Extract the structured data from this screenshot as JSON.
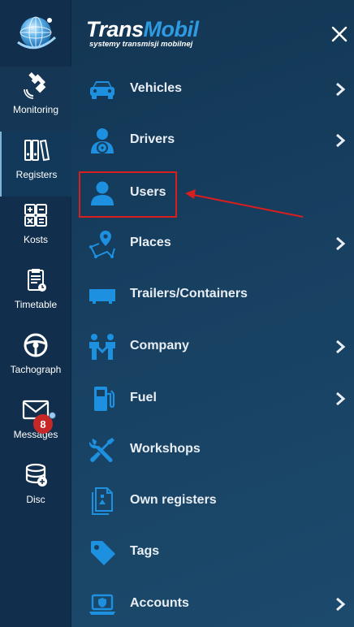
{
  "brand": {
    "name_part1": "Trans",
    "name_part2": "Mobil",
    "subtitle": "systemy transmisji mobilnej"
  },
  "rail": {
    "items": [
      {
        "label": "Monitoring",
        "icon": "satellite-icon"
      },
      {
        "label": "Registers",
        "icon": "binders-icon"
      },
      {
        "label": "Kosts",
        "icon": "calculator-icon"
      },
      {
        "label": "Timetable",
        "icon": "clipboard-icon"
      },
      {
        "label": "Tachograph",
        "icon": "steering-wheel-icon"
      },
      {
        "label": "Messages",
        "icon": "envelope-icon"
      },
      {
        "label": "Disc",
        "icon": "database-icon"
      }
    ],
    "messages_badge": "8"
  },
  "menu": {
    "items": [
      {
        "label": "Vehicles",
        "icon": "car-icon",
        "has_submenu": true
      },
      {
        "label": "Drivers",
        "icon": "driver-icon",
        "has_submenu": true
      },
      {
        "label": "Users",
        "icon": "user-icon",
        "has_submenu": false
      },
      {
        "label": "Places",
        "icon": "map-location-icon",
        "has_submenu": true
      },
      {
        "label": "Trailers/Containers",
        "icon": "trailer-icon",
        "has_submenu": false
      },
      {
        "label": "Company",
        "icon": "people-icon",
        "has_submenu": true
      },
      {
        "label": "Fuel",
        "icon": "fuel-pump-icon",
        "has_submenu": true
      },
      {
        "label": "Workshops",
        "icon": "tools-icon",
        "has_submenu": false
      },
      {
        "label": "Own registers",
        "icon": "documents-icon",
        "has_submenu": false
      },
      {
        "label": "Tags",
        "icon": "tag-icon",
        "has_submenu": false
      },
      {
        "label": "Accounts",
        "icon": "laptop-shield-icon",
        "has_submenu": true
      }
    ],
    "highlighted": "Users"
  },
  "colors": {
    "background": "#173f60",
    "rail": "#112f4c",
    "accent_blue": "#2f9ae0",
    "icon_blue": "#1e90e0",
    "highlight_red": "#d81e1e",
    "badge_red": "#c62828"
  }
}
